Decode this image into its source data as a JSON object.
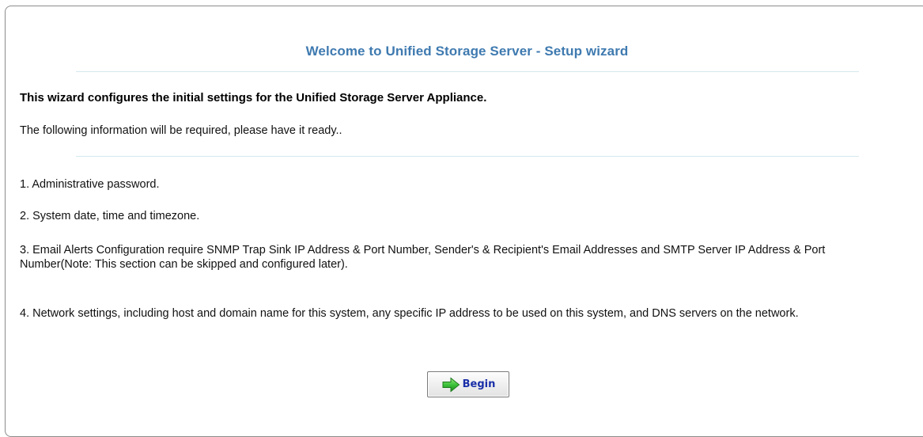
{
  "wizard": {
    "title": "Welcome to Unified Storage Server - Setup wizard",
    "lead": "This wizard configures the initial settings for the Unified Storage Server Appliance.",
    "required_note": "The following information will be required, please have it ready..",
    "items": [
      "1. Administrative password.",
      "2. System date, time and timezone.",
      "3. Email Alerts Configuration require SNMP Trap Sink IP Address & Port Number, Sender's & Recipient's Email Addresses and SMTP Server IP Address & Port Number(Note: This section can be skipped and configured later).",
      "4. Network settings, including host and domain name for this system, any specific IP address to be used on this system, and DNS servers on the network."
    ],
    "begin_button": {
      "label": "Begin",
      "icon": "green-arrow-right-icon"
    },
    "colors": {
      "title": "#3f7ab0",
      "rule": "#d4e8ee",
      "button_label": "#1a2fa8",
      "arrow": "#2fb52f"
    }
  }
}
